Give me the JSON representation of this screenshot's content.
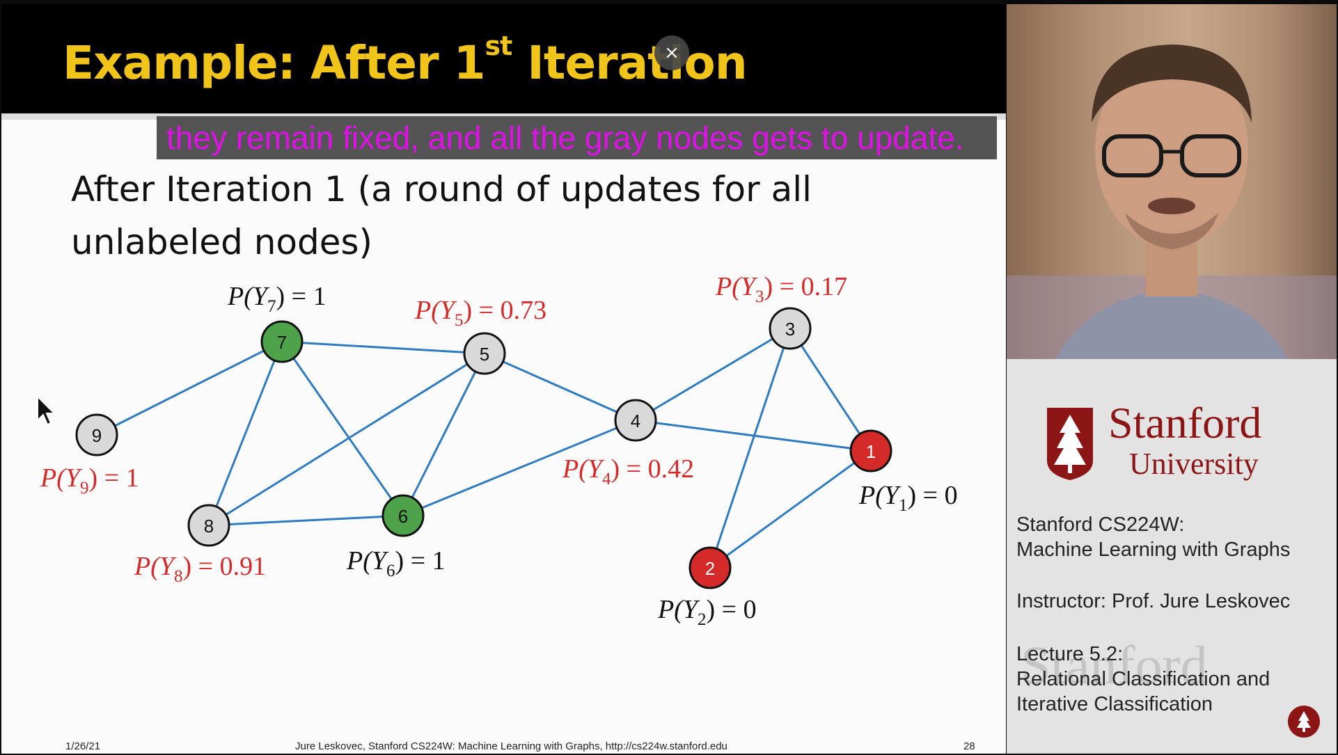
{
  "slide": {
    "title_prefix": "Example: After 1",
    "title_sup": "st",
    "title_suffix": " Iteration",
    "caption": "they remain fixed, and all the gray nodes gets to update.",
    "body_line1": "After Iteration 1 (a round of updates for all",
    "body_line2": "unlabeled nodes)",
    "footer_date": "1/26/21",
    "footer_credit": "Jure Leskovec, Stanford CS224W: Machine Learning with Graphs, http://cs224w.stanford.edu",
    "footer_page": "28"
  },
  "overlay": {
    "close_symbol": "×"
  },
  "graph": {
    "nodes": [
      {
        "id": "1",
        "status": "red",
        "prob_name": "P(Y",
        "prob_sub": "1",
        "prob_value": ") = 0"
      },
      {
        "id": "2",
        "status": "red",
        "prob_name": "P(Y",
        "prob_sub": "2",
        "prob_value": ") = 0"
      },
      {
        "id": "3",
        "status": "gray",
        "prob_name": "P(Y",
        "prob_sub": "3",
        "prob_value": ") = 0.17"
      },
      {
        "id": "4",
        "status": "gray",
        "prob_name": "P(Y",
        "prob_sub": "4",
        "prob_value": ") = 0.42"
      },
      {
        "id": "5",
        "status": "gray",
        "prob_name": "P(Y",
        "prob_sub": "5",
        "prob_value": ") = 0.73"
      },
      {
        "id": "6",
        "status": "green",
        "prob_name": "P(Y",
        "prob_sub": "6",
        "prob_value": ") = 1"
      },
      {
        "id": "7",
        "status": "green",
        "prob_name": "P(Y",
        "prob_sub": "7",
        "prob_value": ") = 1"
      },
      {
        "id": "8",
        "status": "gray",
        "prob_name": "P(Y",
        "prob_sub": "8",
        "prob_value": ") = 0.91"
      },
      {
        "id": "9",
        "status": "gray",
        "prob_name": "P(Y",
        "prob_sub": "9",
        "prob_value": ") = 1"
      }
    ],
    "edges": [
      [
        "9",
        "7"
      ],
      [
        "7",
        "5"
      ],
      [
        "7",
        "8"
      ],
      [
        "7",
        "6"
      ],
      [
        "5",
        "8"
      ],
      [
        "5",
        "6"
      ],
      [
        "5",
        "4"
      ],
      [
        "8",
        "6"
      ],
      [
        "6",
        "4"
      ],
      [
        "4",
        "3"
      ],
      [
        "4",
        "1"
      ],
      [
        "3",
        "1"
      ],
      [
        "3",
        "2"
      ],
      [
        "2",
        "1"
      ]
    ],
    "colors": {
      "edge": "#2f7bbf",
      "gray": "#d9d9d9",
      "green": "#4ea24a",
      "red": "#d42a2a",
      "updated_label": "#d42a2a",
      "fixed_label": "#111111"
    }
  },
  "sidebar": {
    "brand_name": "Stanford",
    "brand_sub": "University",
    "course_line1": "Stanford CS224W:",
    "course_line2": "Machine Learning with Graphs",
    "instructor": "Instructor: Prof. Jure Leskovec",
    "lecture_line1": "Lecture 5.2:",
    "lecture_line2": "Relational Classification and",
    "lecture_line3": "Iterative Classification",
    "watermark": "Stanford",
    "brand_color": "#8c1515",
    "badge_icon": "stanford-tree-icon"
  }
}
